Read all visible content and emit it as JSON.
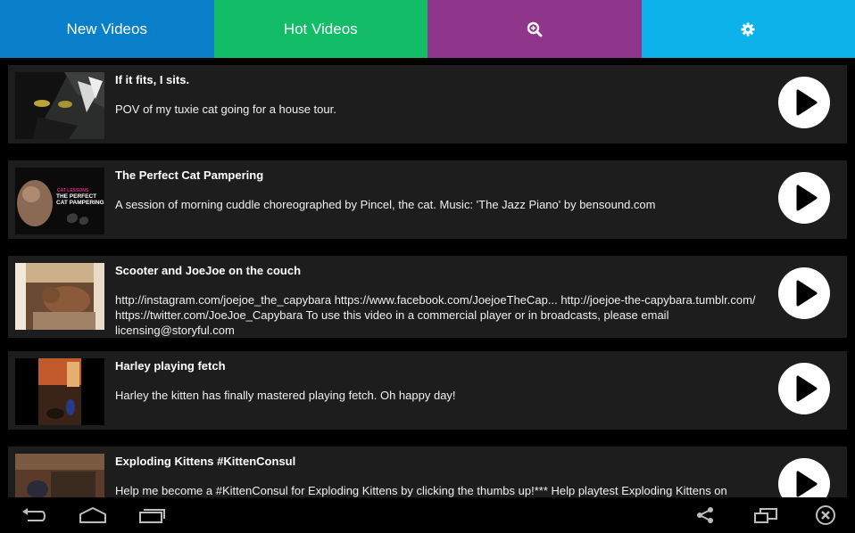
{
  "tabs": [
    {
      "label": "New Videos",
      "color": "#0a7fc9"
    },
    {
      "label": "Hot Videos",
      "color": "#13bd67"
    },
    {
      "label": "",
      "icon": "search-icon",
      "color": "#8f358b"
    },
    {
      "label": "",
      "icon": "gear-icon",
      "color": "#0db2ea"
    }
  ],
  "videos": [
    {
      "title": "If it fits, I sits.",
      "description": "POV of my tuxie cat going for a house tour."
    },
    {
      "title": "The Perfect Cat Pampering",
      "description": "A session of morning cuddle choreographed by Pincel, the cat. Music: 'The Jazz Piano' by bensound.com",
      "thumb_text_small": "CAT LESSONS",
      "thumb_text": "THE PERFECT CAT PAMPERING"
    },
    {
      "title": "Scooter and JoeJoe on the couch",
      "description": "http://instagram.com/joejoe_the_capybara https://www.facebook.com/JoejoeTheCap... http://joejoe-the-capybara.tumblr.com/ https://twitter.com/JoeJoe_Capybara To use this video in a commercial player or in broadcasts, please email licensing@storyful.com"
    },
    {
      "title": "Harley playing fetch",
      "description": "Harley the kitten has finally mastered playing fetch. Oh happy day!"
    },
    {
      "title": "Exploding Kittens #KittenConsul",
      "description": "Help me become a #KittenConsul for Exploding Kittens by clicking the thumbs up!*** Help playtest Exploding Kittens on"
    }
  ],
  "navbar": {
    "left": [
      "back-icon",
      "home-icon",
      "recent-apps-icon"
    ],
    "right": [
      "share-icon",
      "window-icon",
      "close-icon"
    ]
  }
}
